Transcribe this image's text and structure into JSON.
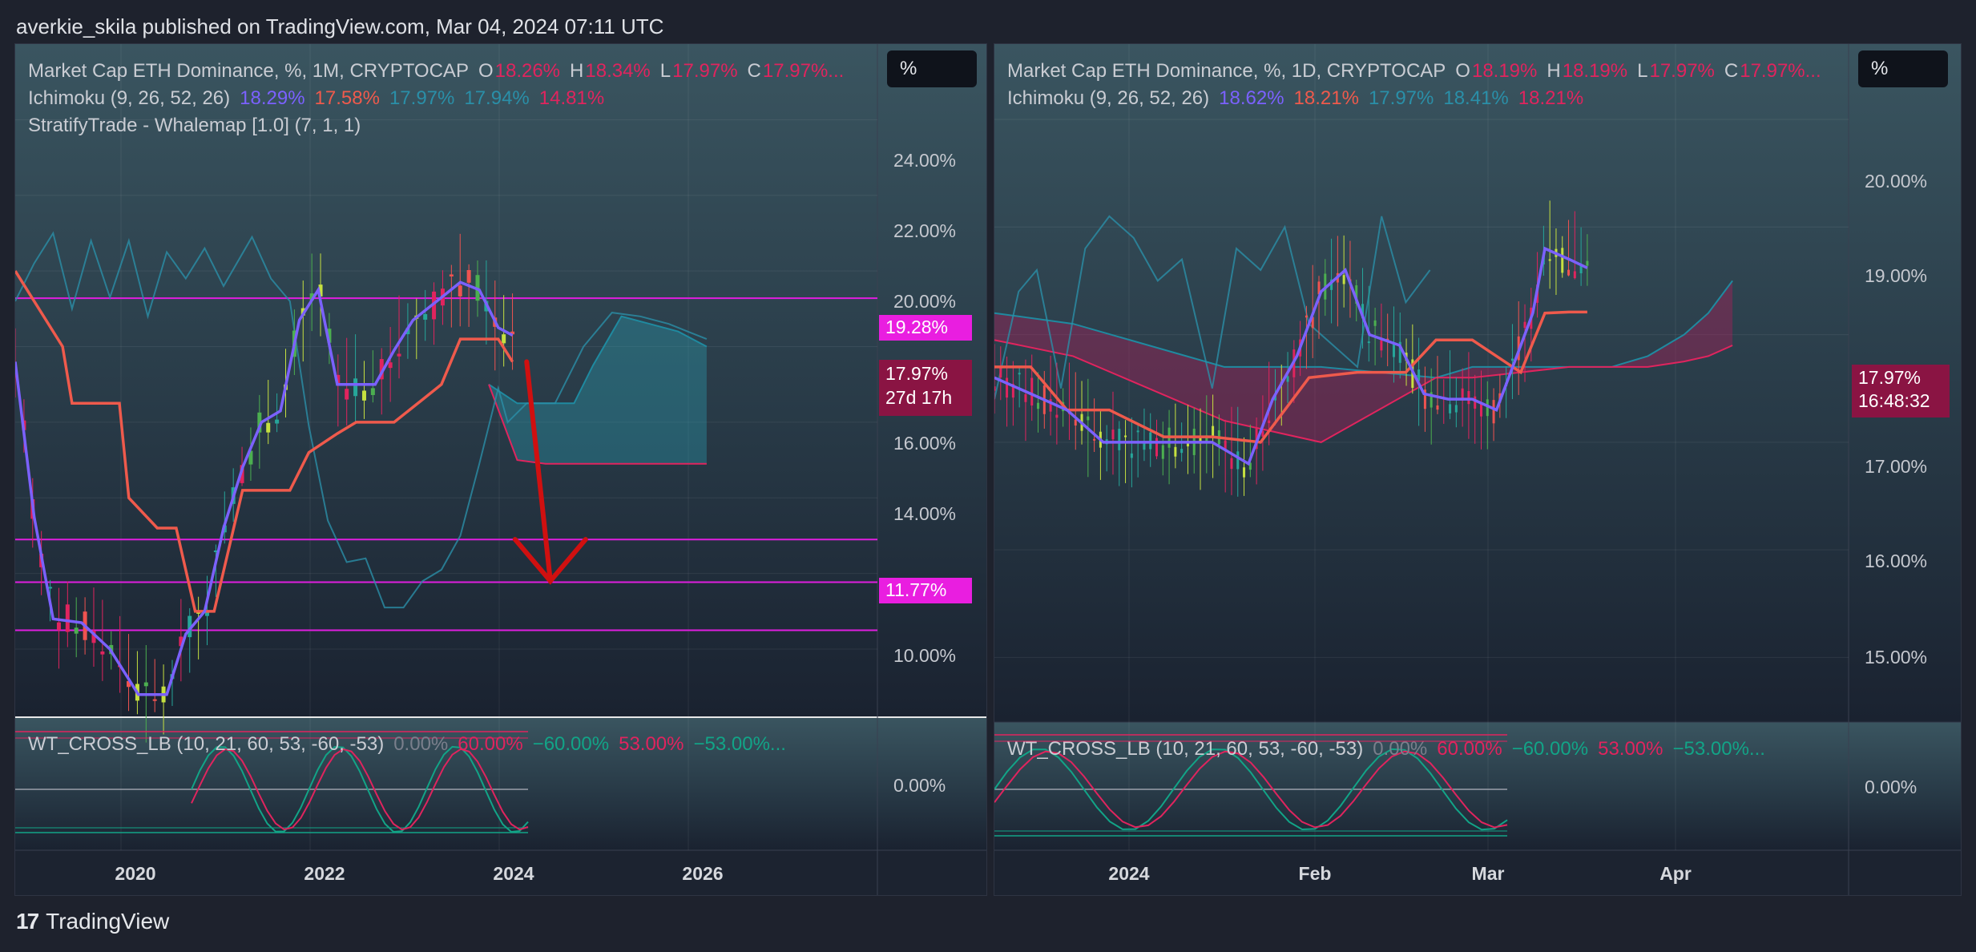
{
  "header": {
    "published": "averkie_skila published on TradingView.com, Mar 04, 2024 07:11 UTC"
  },
  "footer": {
    "brand": "TradingView",
    "logo_glyph": "17"
  },
  "colors": {
    "tenkan": "#7b61ff",
    "kijun": "#ef5a4c",
    "senkou": "#1f8aa0",
    "chikou": "#2a8fa8",
    "hline": "#e01edf",
    "arrow": "#d01010",
    "tag_pink": "#e91ee0",
    "tag_maroon": "#8a1443"
  },
  "left": {
    "legend": {
      "main": {
        "text": "Market Cap ETH Dominance, %, 1M, CRYPTOCAP",
        "o_label": "O",
        "o_value": "18.26%",
        "h_label": "H",
        "h_value": "18.34%",
        "l_label": "L",
        "l_value": "17.97%",
        "c_label": "C",
        "c_value": "17.97%..."
      },
      "ichimoku": {
        "text": "Ichimoku (9, 26, 52, 26)",
        "v1": "18.29%",
        "v2": "17.58%",
        "v3": "17.97%",
        "v4": "17.94%",
        "v5": "14.81%"
      },
      "whalemap": {
        "text": "StratifyTrade - Whalemap [1.0] (7, 1, 1)"
      },
      "wt": {
        "text": "WT_CROSS_LB (10, 21, 60, 53, -60, -53)",
        "v1": "0.00%",
        "v2": "60.00%",
        "v3": "−60.00%",
        "v4": "53.00%",
        "v5": "−53.00%..."
      }
    },
    "scale_button": "%",
    "y_ticks": [
      "24.00%",
      "22.00%",
      "20.00%",
      "16.00%",
      "14.00%",
      "10.00%"
    ],
    "osc_tick": "0.00%",
    "x_ticks": [
      "2020",
      "2022",
      "2024",
      "2026"
    ],
    "tags": {
      "level_high": "19.28%",
      "price": "17.97%",
      "countdown": "27d 17h",
      "level_low": "11.77%"
    }
  },
  "right": {
    "legend": {
      "main": {
        "text": "Market Cap ETH Dominance, %, 1D, CRYPTOCAP",
        "o_label": "O",
        "o_value": "18.19%",
        "h_label": "H",
        "h_value": "18.19%",
        "l_label": "L",
        "l_value": "17.97%",
        "c_label": "C",
        "c_value": "17.97%..."
      },
      "ichimoku": {
        "text": "Ichimoku (9, 26, 52, 26)",
        "v1": "18.62%",
        "v2": "18.21%",
        "v3": "17.97%",
        "v4": "18.41%",
        "v5": "18.21%"
      },
      "wt": {
        "text": "WT_CROSS_LB (10, 21, 60, 53, -60, -53)",
        "v1": "0.00%",
        "v2": "60.00%",
        "v3": "−60.00%",
        "v4": "53.00%",
        "v5": "−53.00%..."
      }
    },
    "scale_button": "%",
    "y_ticks": [
      "20.00%",
      "19.00%",
      "17.00%",
      "16.00%",
      "15.00%"
    ],
    "osc_tick": "0.00%",
    "x_ticks": [
      "2024",
      "Feb",
      "Mar",
      "Apr"
    ],
    "tags": {
      "price": "17.97%",
      "countdown": "16:48:32"
    }
  },
  "chart_data": [
    {
      "type": "line",
      "title": "Market Cap ETH Dominance, %, 1M, CRYPTOCAP",
      "y_unit": "%",
      "ylim": [
        8.2,
        26.0
      ],
      "xlim": [
        2018.9,
        2028.0
      ],
      "horizontal_levels": [
        19.28,
        12.9,
        11.77,
        10.5
      ],
      "projection_arrow": {
        "from": [
          2024.3,
          17.6
        ],
        "to": [
          2024.55,
          11.8
        ]
      },
      "series": [
        {
          "name": "Tenkan",
          "x": [
            2018.9,
            2019.1,
            2019.3,
            2019.6,
            2019.9,
            2020.2,
            2020.5,
            2020.7,
            2020.9,
            2021.1,
            2021.3,
            2021.5,
            2021.7,
            2021.9,
            2022.1,
            2022.3,
            2022.5,
            2022.7,
            2022.9,
            2023.1,
            2023.4,
            2023.6,
            2023.8,
            2024.0,
            2024.15
          ],
          "values": [
            17.6,
            13.5,
            10.8,
            10.7,
            10.0,
            8.8,
            8.8,
            10.4,
            11.0,
            13.2,
            14.8,
            16.0,
            16.3,
            18.7,
            19.5,
            17.0,
            17.0,
            17.0,
            17.9,
            18.7,
            19.3,
            19.7,
            19.5,
            18.5,
            18.3
          ]
        },
        {
          "name": "Kijun",
          "x": [
            2018.9,
            2019.4,
            2019.5,
            2019.7,
            2020.0,
            2020.1,
            2020.4,
            2020.6,
            2020.8,
            2021.0,
            2021.3,
            2021.6,
            2021.8,
            2022.0,
            2022.3,
            2022.5,
            2022.7,
            2022.9,
            2023.2,
            2023.4,
            2023.6,
            2023.9,
            2024.0,
            2024.15
          ],
          "values": [
            20.0,
            18.0,
            16.5,
            16.5,
            16.5,
            14.0,
            13.2,
            13.2,
            11.0,
            11.0,
            14.2,
            14.2,
            14.2,
            15.2,
            15.7,
            16.0,
            16.0,
            16.0,
            16.6,
            17.0,
            18.2,
            18.2,
            18.2,
            17.6
          ]
        },
        {
          "name": "Lagging span",
          "x": [
            2018.9,
            2019.1,
            2019.3,
            2019.5,
            2019.7,
            2019.9,
            2020.1,
            2020.3,
            2020.5,
            2020.7,
            2020.9,
            2021.1,
            2021.4,
            2021.6,
            2021.8,
            2022.0,
            2022.2,
            2022.4,
            2022.6,
            2022.8,
            2023.0,
            2023.2,
            2023.4,
            2023.6,
            2023.8,
            2024.0,
            2024.1,
            2024.3,
            2024.6,
            2024.9,
            2025.2,
            2025.5,
            2025.8,
            2026.0,
            2026.2
          ],
          "values": [
            19.2,
            20.2,
            21.0,
            19.0,
            20.8,
            19.3,
            20.8,
            18.8,
            20.5,
            19.8,
            20.6,
            19.6,
            20.9,
            19.8,
            19.2,
            15.9,
            13.4,
            12.3,
            12.4,
            11.1,
            11.1,
            11.8,
            12.1,
            13.0,
            14.9,
            16.9,
            16.0,
            16.5,
            16.5,
            18.0,
            18.9,
            18.8,
            18.6,
            18.4,
            18.2
          ]
        },
        {
          "name": "Cloud upper",
          "x": [
            2023.9,
            2024.2,
            2024.5,
            2024.8,
            2025.0,
            2025.3,
            2025.6,
            2025.9,
            2026.2
          ],
          "values": [
            17.0,
            16.5,
            16.5,
            16.5,
            17.5,
            18.8,
            18.6,
            18.4,
            18.0
          ]
        },
        {
          "name": "Cloud lower",
          "x": [
            2023.9,
            2024.2,
            2024.5,
            2024.8,
            2025.0,
            2025.3,
            2025.6,
            2025.9,
            2026.2
          ],
          "values": [
            17.0,
            15.0,
            14.9,
            14.9,
            14.9,
            14.9,
            14.9,
            14.9,
            14.9
          ]
        }
      ]
    },
    {
      "type": "line",
      "title": "Market Cap ETH Dominance, %, 1D, CRYPTOCAP",
      "y_unit": "%",
      "ylim": [
        14.4,
        20.7
      ],
      "series": [
        {
          "name": "Tenkan",
          "x": [
            "2023-11-27",
            "2023-12-03",
            "2023-12-09",
            "2023-12-15",
            "2023-12-21",
            "2023-12-27",
            "2024-01-02",
            "2024-01-08",
            "2024-01-12",
            "2024-01-16",
            "2024-01-20",
            "2024-01-24",
            "2024-01-28",
            "2024-02-02",
            "2024-02-06",
            "2024-02-10",
            "2024-02-14",
            "2024-02-18",
            "2024-02-22",
            "2024-02-24",
            "2024-02-26",
            "2024-03-01",
            "2024-03-04"
          ],
          "values": [
            17.6,
            17.45,
            17.3,
            17.0,
            17.0,
            17.0,
            17.0,
            16.8,
            17.4,
            17.8,
            18.4,
            18.6,
            18.0,
            17.9,
            17.45,
            17.4,
            17.4,
            17.3,
            17.9,
            18.2,
            18.8,
            18.7,
            18.62
          ]
        },
        {
          "name": "Kijun",
          "x": [
            "2023-11-27",
            "2023-12-03",
            "2023-12-09",
            "2023-12-16",
            "2023-12-25",
            "2024-01-02",
            "2024-01-10",
            "2024-01-18",
            "2024-01-26",
            "2024-02-03",
            "2024-02-08",
            "2024-02-14",
            "2024-02-18",
            "2024-02-22",
            "2024-02-26",
            "2024-03-01",
            "2024-03-04"
          ],
          "values": [
            17.7,
            17.7,
            17.3,
            17.3,
            17.05,
            17.05,
            17.0,
            17.6,
            17.65,
            17.65,
            17.95,
            17.95,
            17.8,
            17.65,
            18.2,
            18.21,
            18.21
          ]
        },
        {
          "name": "Lagging span",
          "x": [
            "2023-11-27",
            "2023-12-01",
            "2023-12-04",
            "2023-12-08",
            "2023-12-12",
            "2023-12-16",
            "2023-12-20",
            "2023-12-24",
            "2023-12-28",
            "2024-01-02",
            "2024-01-06",
            "2024-01-10",
            "2024-01-14",
            "2024-01-18",
            "2024-01-22",
            "2024-01-26",
            "2024-01-30",
            "2024-02-03",
            "2024-02-07"
          ],
          "values": [
            17.4,
            18.4,
            18.6,
            17.5,
            18.8,
            19.1,
            18.9,
            18.5,
            18.7,
            17.5,
            18.8,
            18.6,
            19.0,
            18.1,
            17.9,
            17.7,
            19.1,
            18.3,
            18.6
          ]
        },
        {
          "name": "Cloud upper",
          "x": [
            "2023-11-27",
            "2023-12-10",
            "2024-01-04",
            "2024-01-20",
            "2024-02-08",
            "2024-02-14",
            "2024-02-22",
            "2024-03-01",
            "2024-03-08",
            "2024-03-14",
            "2024-03-20",
            "2024-03-24",
            "2024-03-28"
          ],
          "values": [
            18.2,
            18.1,
            17.7,
            17.7,
            17.6,
            17.7,
            17.7,
            17.7,
            17.7,
            17.8,
            18.0,
            18.2,
            18.5
          ]
        },
        {
          "name": "Cloud lower",
          "x": [
            "2023-11-27",
            "2023-12-10",
            "2024-01-04",
            "2024-01-20",
            "2024-02-08",
            "2024-02-14",
            "2024-02-22",
            "2024-03-01",
            "2024-03-08",
            "2024-03-14",
            "2024-03-20",
            "2024-03-24",
            "2024-03-28"
          ],
          "values": [
            17.95,
            17.8,
            17.2,
            17.0,
            17.6,
            17.6,
            17.65,
            17.7,
            17.7,
            17.7,
            17.75,
            17.8,
            17.9
          ]
        }
      ]
    }
  ]
}
